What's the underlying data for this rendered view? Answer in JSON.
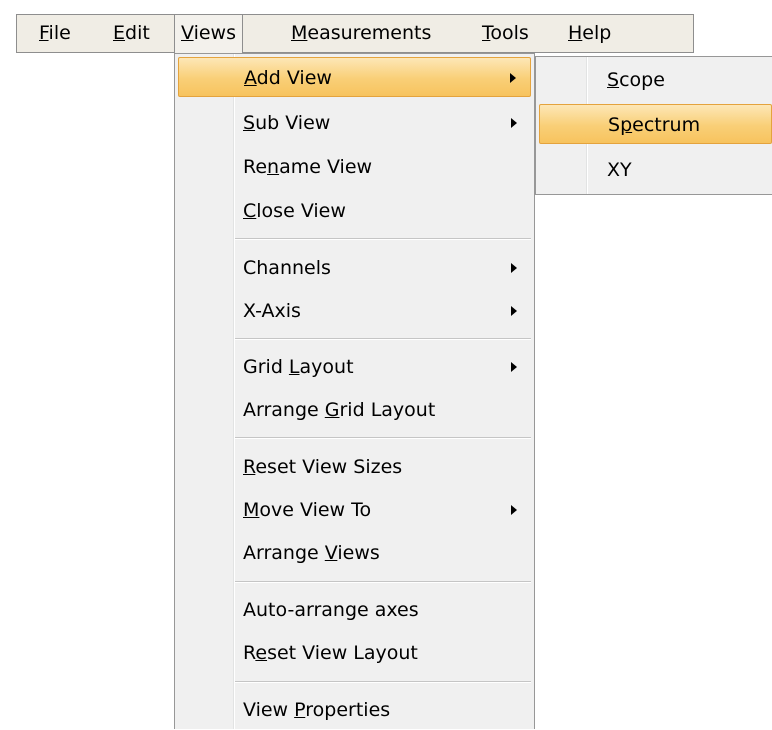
{
  "menubar": {
    "items": [
      {
        "pre": "",
        "key": "F",
        "post": "ile"
      },
      {
        "pre": "",
        "key": "E",
        "post": "dit"
      },
      {
        "pre": "",
        "key": "V",
        "post": "iews"
      },
      {
        "pre": "",
        "key": "M",
        "post": "easurements"
      },
      {
        "pre": "",
        "key": "T",
        "post": "ools"
      },
      {
        "pre": "",
        "key": "H",
        "post": "elp"
      }
    ]
  },
  "views_menu": {
    "items": [
      {
        "pre": "",
        "key": "A",
        "post": "dd View",
        "submenu": true
      },
      {
        "pre": "",
        "key": "S",
        "post": "ub View",
        "submenu": true
      },
      {
        "pre": "Re",
        "key": "n",
        "post": "ame View",
        "submenu": false
      },
      {
        "pre": "",
        "key": "C",
        "post": "lose View",
        "submenu": false
      },
      {
        "pre": "Channels",
        "key": "",
        "post": "",
        "submenu": true
      },
      {
        "pre": "X-Axis",
        "key": "",
        "post": "",
        "submenu": true
      },
      {
        "pre": "Grid ",
        "key": "L",
        "post": "ayout",
        "submenu": true
      },
      {
        "pre": "Arrange ",
        "key": "G",
        "post": "rid Layout",
        "submenu": false
      },
      {
        "pre": "",
        "key": "R",
        "post": "eset View Sizes",
        "submenu": false
      },
      {
        "pre": "",
        "key": "M",
        "post": "ove View To",
        "submenu": true
      },
      {
        "pre": "Arrange ",
        "key": "V",
        "post": "iews",
        "submenu": false
      },
      {
        "pre": "Auto-arrange axes",
        "key": "",
        "post": "",
        "submenu": false
      },
      {
        "pre": "R",
        "key": "e",
        "post": "set View Layout",
        "submenu": false
      },
      {
        "pre": "View ",
        "key": "P",
        "post": "roperties",
        "submenu": false
      }
    ]
  },
  "add_view_submenu": {
    "items": [
      {
        "pre": "",
        "key": "S",
        "post": "cope"
      },
      {
        "pre": "S",
        "key": "p",
        "post": "ectrum"
      },
      {
        "pre": "XY",
        "key": "",
        "post": ""
      }
    ]
  },
  "colors": {
    "highlight_top": "#fde7b6",
    "highlight_bottom": "#f7c35e",
    "highlight_border": "#e4a33d",
    "menu_bg": "#f0f0f0",
    "menubar_bg": "#f0ede5"
  }
}
